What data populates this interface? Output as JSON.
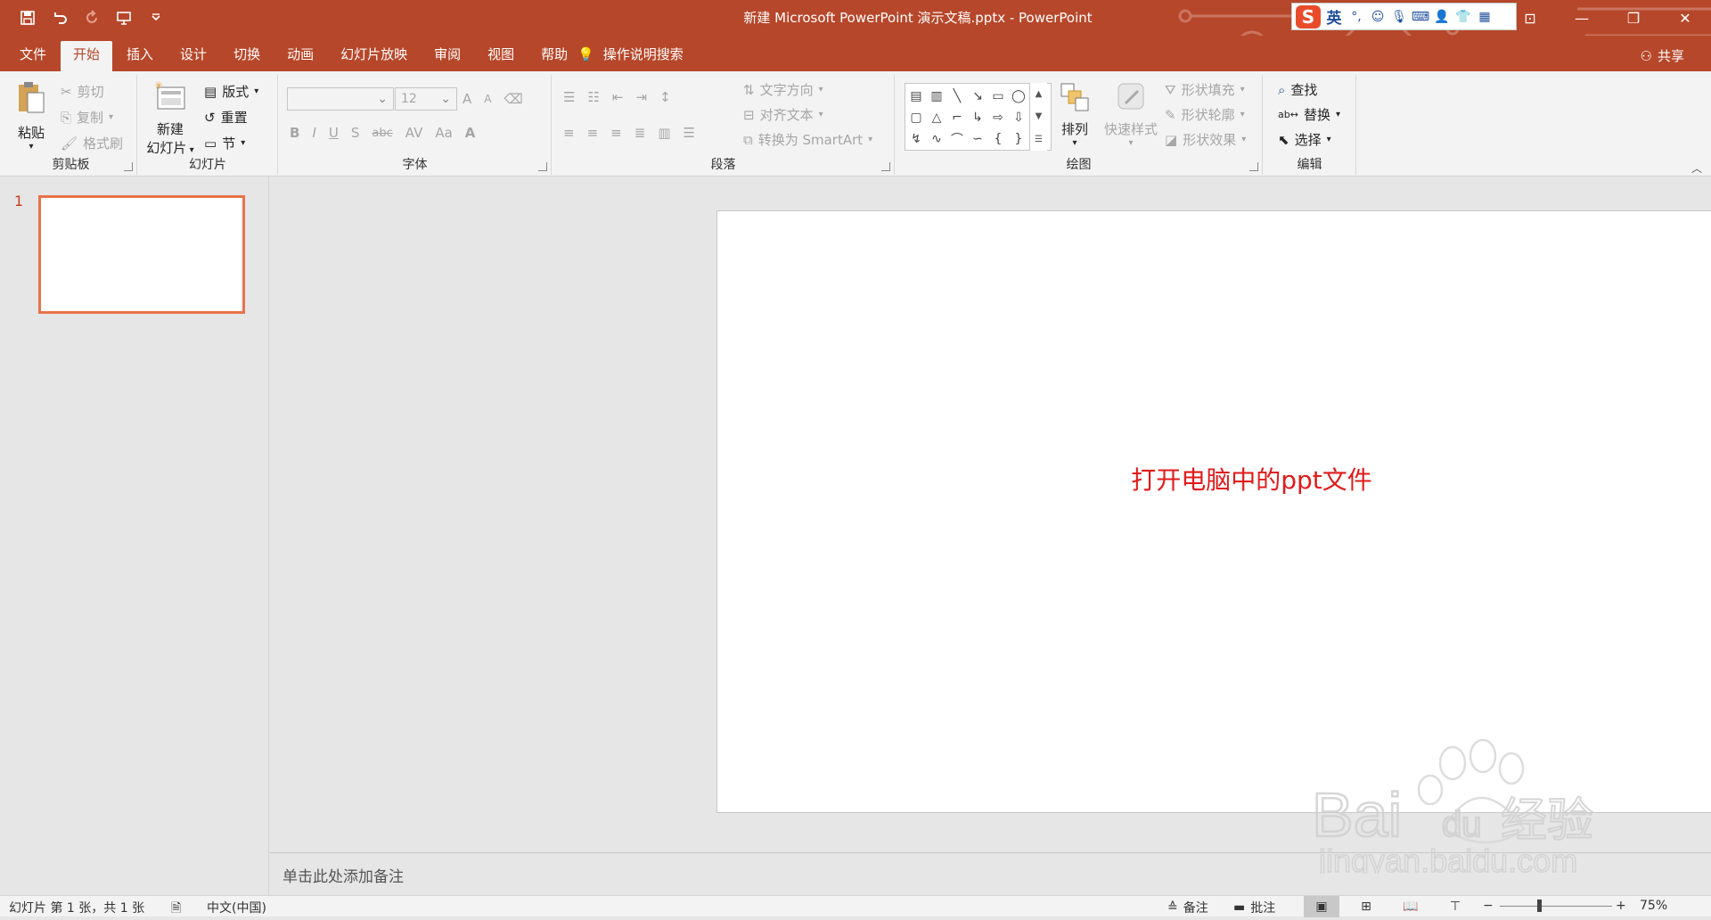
{
  "window": {
    "title": "新建 Microsoft PowerPoint 演示文稿.pptx  -  PowerPoint"
  },
  "ime": {
    "logo": "S",
    "mode": "英",
    "punct": "°,"
  },
  "menu": {
    "tabs": [
      {
        "label": "文件"
      },
      {
        "label": "开始"
      },
      {
        "label": "插入"
      },
      {
        "label": "设计"
      },
      {
        "label": "切换"
      },
      {
        "label": "动画"
      },
      {
        "label": "幻灯片放映"
      },
      {
        "label": "审阅"
      },
      {
        "label": "视图"
      },
      {
        "label": "帮助"
      }
    ],
    "active_tab": "开始",
    "tell_me": "操作说明搜索",
    "share": "共享"
  },
  "ribbon": {
    "clipboard": {
      "label": "剪贴板",
      "paste": "粘贴",
      "cut": "剪切",
      "copy": "复制",
      "format_painter": "格式刷"
    },
    "slides": {
      "label": "幻灯片",
      "new_slide_1": "新建",
      "new_slide_2": "幻灯片",
      "layout": "版式",
      "reset": "重置",
      "section": "节"
    },
    "font": {
      "label": "字体",
      "font_name": "",
      "font_size": "12",
      "bold": "B",
      "italic": "I",
      "underline": "U",
      "shadow": "S",
      "strike": "abc",
      "spacing": "AV",
      "case": "Aa",
      "color": "A",
      "grow": "A",
      "shrink": "A"
    },
    "paragraph": {
      "label": "段落",
      "text_direction": "文字方向",
      "align_text": "对齐文本",
      "smartart": "转换为 SmartArt"
    },
    "drawing": {
      "label": "绘图",
      "arrange": "排列",
      "quick_styles": "快速样式",
      "shape_fill": "形状填充",
      "shape_outline": "形状轮廓",
      "shape_effects": "形状效果"
    },
    "editing": {
      "label": "编辑",
      "find": "查找",
      "replace": "替换",
      "select": "选择"
    }
  },
  "thumbnails": {
    "slide_number": "1"
  },
  "slide": {
    "text": "打开电脑中的ppt文件"
  },
  "notes": {
    "placeholder": "单击此处添加备注"
  },
  "status": {
    "slide_info": "幻灯片 第 1 张，共 1 张",
    "language": "中文(中国)",
    "notes": "备注",
    "comments": "批注",
    "zoom": "75%",
    "zoom_minus": "−",
    "zoom_plus": "+"
  },
  "watermark": {
    "brand": "Bai",
    "brand2": "du",
    "cn": "经验",
    "url": "jingyan.baidu.com"
  },
  "colors": {
    "accent": "#b7472a",
    "slide_text": "#e01b1b",
    "thumb_border": "#e8734a"
  }
}
